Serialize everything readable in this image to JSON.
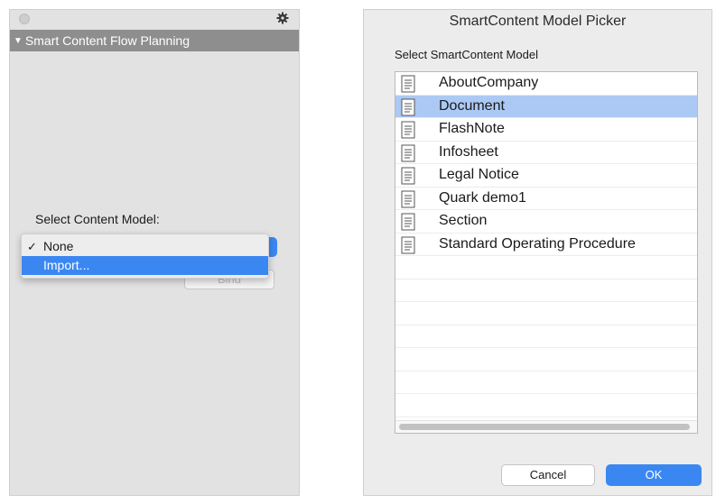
{
  "palette": {
    "section_title": "Smart Content Flow Planning",
    "select_label": "Select Content Model:",
    "menu": {
      "items": [
        {
          "label": "None",
          "checked": true
        },
        {
          "label": "Import...",
          "highlighted": true
        }
      ]
    },
    "bind_label": "Bind",
    "icons": {
      "gear": "gear-icon",
      "disclosure": "disclosure-triangle-icon"
    }
  },
  "dialog": {
    "title": "SmartContent Model Picker",
    "subtitle": "Select SmartContent Model",
    "items": [
      {
        "label": "AboutCompany",
        "selected": false
      },
      {
        "label": "Document",
        "selected": true
      },
      {
        "label": "FlashNote",
        "selected": false
      },
      {
        "label": "Infosheet",
        "selected": false
      },
      {
        "label": "Legal Notice",
        "selected": false
      },
      {
        "label": "Quark demo1",
        "selected": false
      },
      {
        "label": "Section",
        "selected": false
      },
      {
        "label": "Standard Operating Procedure",
        "selected": false
      }
    ],
    "cancel_label": "Cancel",
    "ok_label": "OK"
  },
  "colors": {
    "accent": "#3b87f2",
    "selection": "#abc9f4",
    "header": "#8e8e8e"
  }
}
